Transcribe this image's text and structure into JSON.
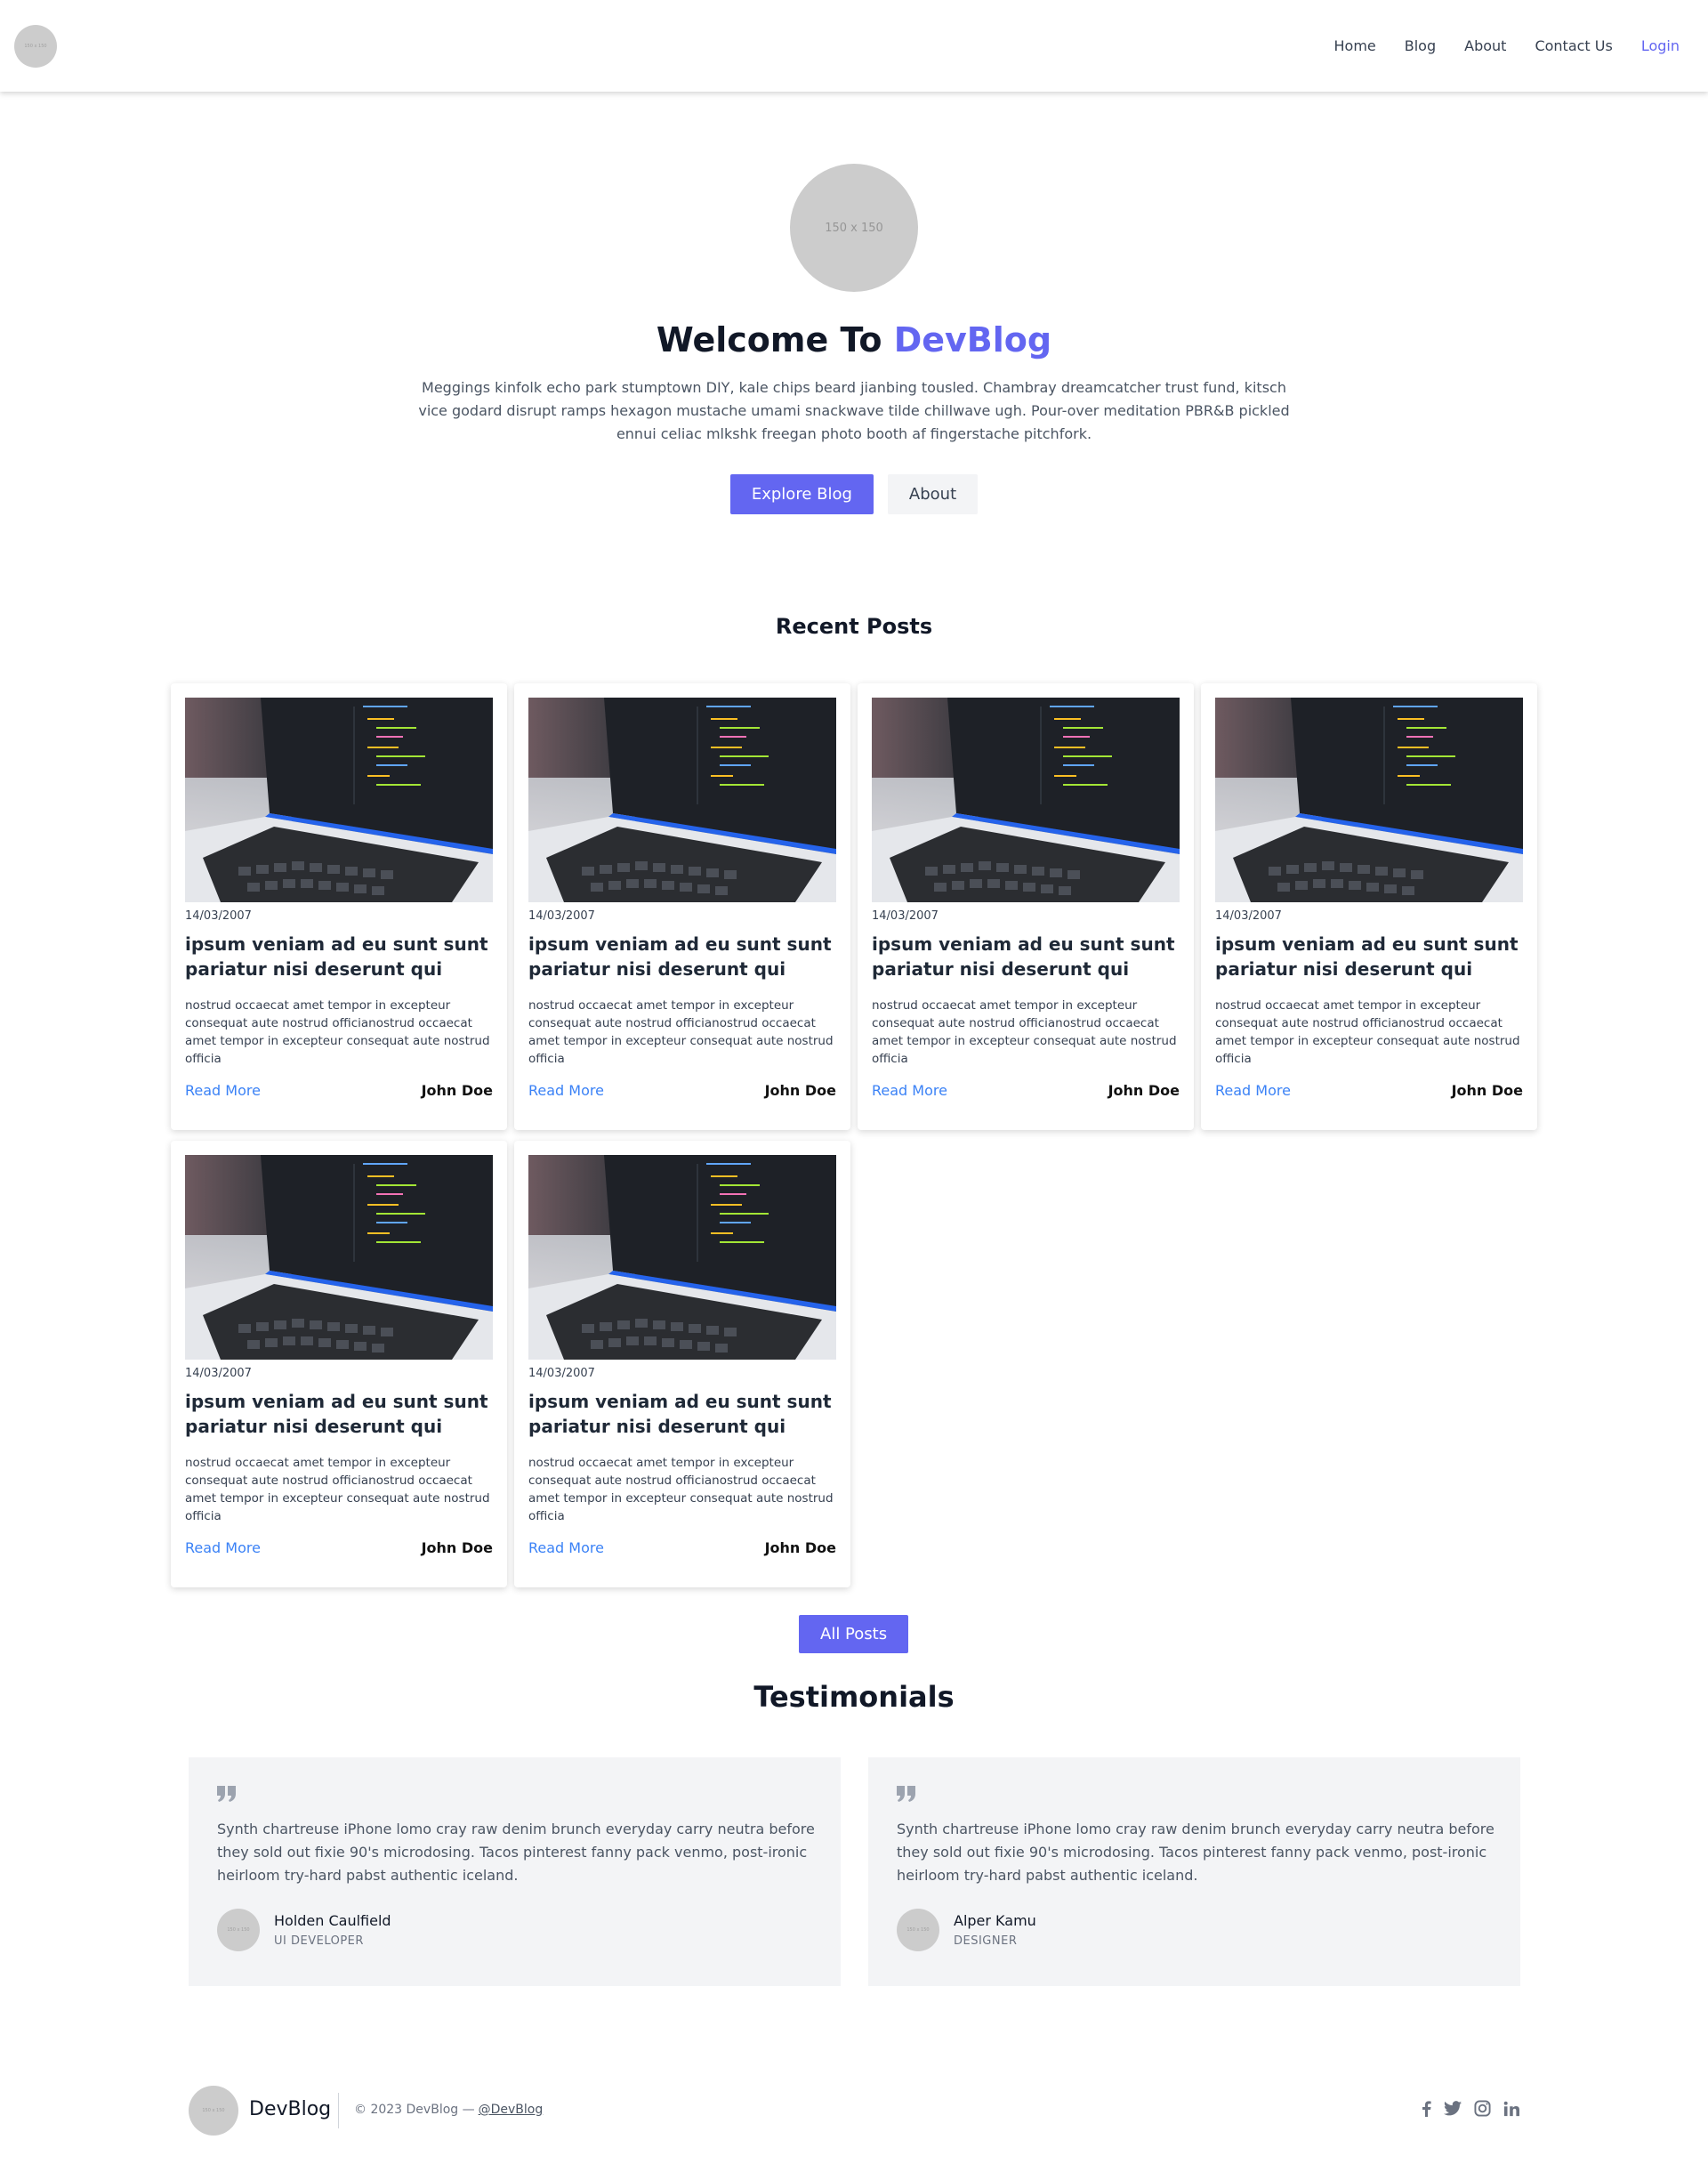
{
  "header": {
    "logo_text": "150 x 150",
    "nav": [
      "Home",
      "Blog",
      "About",
      "Contact Us"
    ],
    "login": "Login"
  },
  "hero": {
    "avatar_text": "150 x 150",
    "title_prefix": "Welcome To",
    "title_accent": "DevBlog",
    "description": "Meggings kinfolk echo park stumptown DIY, kale chips beard jianbing tousled. Chambray dreamcatcher trust fund, kitsch vice godard disrupt ramps hexagon mustache umami snackwave tilde chillwave ugh. Pour-over meditation PBR&B pickled ennui celiac mlkshk freegan photo booth af fingerstache pitchfork.",
    "primary_button": "Explore Blog",
    "secondary_button": "About"
  },
  "recent_posts": {
    "title": "Recent Posts",
    "posts": [
      {
        "date": "14/03/2007",
        "title": "ipsum veniam ad eu sunt sunt pariatur nisi deserunt qui",
        "excerpt": "nostrud occaecat amet tempor in excepteur consequat aute nostrud officianostrud occaecat amet tempor in excepteur consequat aute nostrud officia",
        "read_more": "Read More",
        "author": "John Doe"
      },
      {
        "date": "14/03/2007",
        "title": "ipsum veniam ad eu sunt sunt pariatur nisi deserunt qui",
        "excerpt": "nostrud occaecat amet tempor in excepteur consequat aute nostrud officianostrud occaecat amet tempor in excepteur consequat aute nostrud officia",
        "read_more": "Read More",
        "author": "John Doe"
      },
      {
        "date": "14/03/2007",
        "title": "ipsum veniam ad eu sunt sunt pariatur nisi deserunt qui",
        "excerpt": "nostrud occaecat amet tempor in excepteur consequat aute nostrud officianostrud occaecat amet tempor in excepteur consequat aute nostrud officia",
        "read_more": "Read More",
        "author": "John Doe"
      },
      {
        "date": "14/03/2007",
        "title": "ipsum veniam ad eu sunt sunt pariatur nisi deserunt qui",
        "excerpt": "nostrud occaecat amet tempor in excepteur consequat aute nostrud officianostrud occaecat amet tempor in excepteur consequat aute nostrud officia",
        "read_more": "Read More",
        "author": "John Doe"
      },
      {
        "date": "14/03/2007",
        "title": "ipsum veniam ad eu sunt sunt pariatur nisi deserunt qui",
        "excerpt": "nostrud occaecat amet tempor in excepteur consequat aute nostrud officianostrud occaecat amet tempor in excepteur consequat aute nostrud officia",
        "read_more": "Read More",
        "author": "John Doe"
      },
      {
        "date": "14/03/2007",
        "title": "ipsum veniam ad eu sunt sunt pariatur nisi deserunt qui",
        "excerpt": "nostrud occaecat amet tempor in excepteur consequat aute nostrud officianostrud occaecat amet tempor in excepteur consequat aute nostrud officia",
        "read_more": "Read More",
        "author": "John Doe"
      }
    ],
    "all_posts_button": "All Posts"
  },
  "testimonials": {
    "title": "Testimonials",
    "items": [
      {
        "text": "Synth chartreuse iPhone lomo cray raw denim brunch everyday carry neutra before they sold out fixie 90's microdosing. Tacos pinterest fanny pack venmo, post-ironic heirloom try-hard pabst authentic iceland.",
        "avatar_text": "150 x 150",
        "name": "Holden Caulfield",
        "role": "UI DEVELOPER"
      },
      {
        "text": "Synth chartreuse iPhone lomo cray raw denim brunch everyday carry neutra before they sold out fixie 90's microdosing. Tacos pinterest fanny pack venmo, post-ironic heirloom try-hard pabst authentic iceland.",
        "avatar_text": "150 x 150",
        "name": "Alper Kamu",
        "role": "DESIGNER"
      }
    ]
  },
  "footer": {
    "logo_text": "150 x 150",
    "brand": "DevBlog",
    "copyright": "© 2023 DevBlog —",
    "handle": "@DevBlog",
    "social_icons": [
      "facebook-icon",
      "twitter-icon",
      "instagram-icon",
      "linkedin-icon"
    ]
  },
  "colors": {
    "accent": "#6366f1",
    "link": "#3b82f6",
    "placeholder": "#cccccc",
    "testimonial_bg": "#f3f4f6"
  }
}
